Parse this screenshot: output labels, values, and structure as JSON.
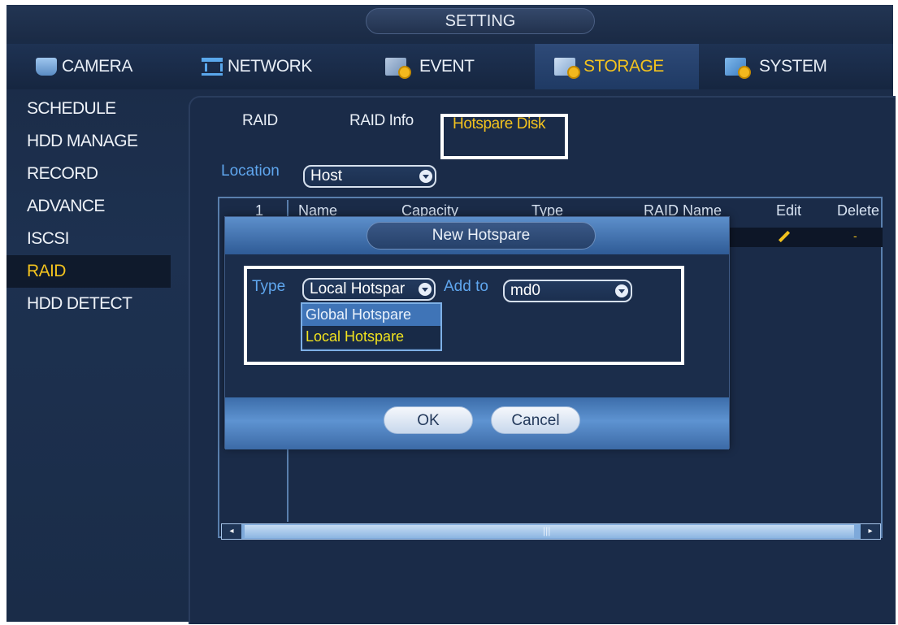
{
  "title": "SETTING",
  "top_nav": [
    {
      "label": "CAMERA",
      "icon": "camera-icon"
    },
    {
      "label": "NETWORK",
      "icon": "network-icon"
    },
    {
      "label": "EVENT",
      "icon": "event-icon"
    },
    {
      "label": "STORAGE",
      "icon": "storage-icon",
      "active": true
    },
    {
      "label": "SYSTEM",
      "icon": "system-icon"
    }
  ],
  "sidebar": [
    {
      "label": "SCHEDULE"
    },
    {
      "label": "HDD MANAGE"
    },
    {
      "label": "RECORD"
    },
    {
      "label": "ADVANCE"
    },
    {
      "label": "ISCSI"
    },
    {
      "label": "RAID",
      "active": true
    },
    {
      "label": "HDD DETECT"
    }
  ],
  "sub_tabs": [
    {
      "label": "RAID"
    },
    {
      "label": "RAID Info"
    },
    {
      "label": "Hotspare Disk",
      "active": true
    }
  ],
  "location": {
    "label": "Location",
    "value": "Host"
  },
  "table": {
    "columns": [
      "1",
      "Name",
      "Capacity",
      "Type",
      "RAID Name",
      "Edit",
      "Delete"
    ],
    "row_delete_mark": "-"
  },
  "dialog": {
    "title": "New Hotspare",
    "type_label": "Type",
    "type_value": "Local Hotspar",
    "add_to_label": "Add to",
    "add_to_value": "md0",
    "type_options": [
      "Global Hotspare",
      "Local Hotspare"
    ],
    "ok_label": "OK",
    "cancel_label": "Cancel"
  },
  "scrollbar": {
    "left_arrow": "◂",
    "right_arrow": "▸",
    "thumb_grip": "|||"
  },
  "colors": {
    "accent": "#f2c21e",
    "label_blue": "#5fa6ee",
    "background": "#1a2b48"
  }
}
